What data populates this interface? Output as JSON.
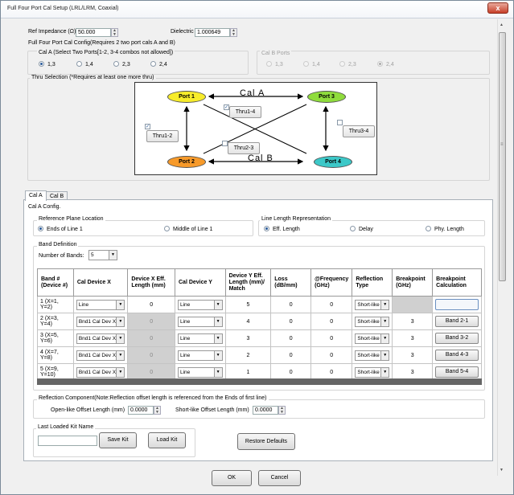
{
  "window": {
    "title": "Full Four Port Cal Setup (LRL/LRM, Coaxial)",
    "close": "x"
  },
  "ref_impedance": {
    "label": "Ref Impedance (Ω)",
    "value": "50.000"
  },
  "dielectric": {
    "label": "Dielectric",
    "value": "1.000649"
  },
  "config_title": "Full Four Port Cal Config(Requires 2 two port cals A and B)",
  "cal_a_ports": {
    "title": "Cal A (Select Two Ports[1-2, 3-4 combos not allowed])",
    "options": [
      "1,3",
      "1,4",
      "2,3",
      "2,4"
    ],
    "selected": "1,3"
  },
  "cal_b_ports": {
    "title": "Cal B Ports",
    "options": [
      "1,3",
      "1,4",
      "2,3",
      "2,4"
    ],
    "selected": "2,4"
  },
  "thru_selection": {
    "title": "Thru Selection (*Requires at least one more thru)"
  },
  "diagram": {
    "ports": [
      "Port 1",
      "Port 2",
      "Port 3",
      "Port 4"
    ],
    "cal_a": "Cal A",
    "cal_b": "Cal B",
    "thrus": [
      "Thru1-4",
      "Thru1-2",
      "Thru2-3",
      "Thru3-4"
    ],
    "checked": [
      "Thru1-4",
      "Thru1-2"
    ],
    "colors": {
      "port1": "#f7ec2a",
      "port2": "#f79a2a",
      "port3": "#8fdc3c",
      "port4": "#3cc8c8"
    }
  },
  "tabs": [
    "Cal A",
    "Cal B"
  ],
  "active_tab": "Cal A",
  "cal_a_config_label": "Cal A Config.",
  "ref_plane": {
    "title": "Reference Plane Location",
    "options": [
      "Ends of Line 1",
      "Middle of Line 1"
    ],
    "selected": "Ends of Line 1"
  },
  "line_length": {
    "title": "Line Length Representation",
    "options": [
      "Eff. Length",
      "Delay",
      "Phy. Length"
    ],
    "selected": "Eff. Length"
  },
  "band_def": {
    "title": "Band Definition",
    "num_bands_label": "Number of Bands:",
    "num_bands": "5"
  },
  "table": {
    "headers": [
      "Band #\n(Device #)",
      "Cal Device X",
      "Device X Eff.\nLength (mm)",
      "Cal Device Y",
      "Device Y Eff.\nLength (mm)/\nMatch",
      "Loss\n(dB/mm)",
      "@Frequency\n(GHz)",
      "Reflection\nType",
      "Breakpoint\n(GHz)",
      "Breakpoint\nCalculation"
    ],
    "rows": [
      {
        "band": "1 (X=1, Y=2)",
        "dev_x": "Line",
        "x_len": "0",
        "dev_y": "Line",
        "y_len": "5",
        "loss": "0",
        "freq": "0",
        "refl": "Short-like",
        "bp": "",
        "calc": ""
      },
      {
        "band": "2 (X=3, Y=4)",
        "dev_x": "Bnd1 Cal Dev X",
        "x_len": "0",
        "dev_y": "Line",
        "y_len": "4",
        "loss": "0",
        "freq": "0",
        "refl": "Short-like",
        "bp": "3",
        "calc": "Band 2-1"
      },
      {
        "band": "3 (X=5, Y=6)",
        "dev_x": "Bnd1 Cal Dev X",
        "x_len": "0",
        "dev_y": "Line",
        "y_len": "3",
        "loss": "0",
        "freq": "0",
        "refl": "Short-like",
        "bp": "3",
        "calc": "Band 3-2"
      },
      {
        "band": "4 (X=7, Y=8)",
        "dev_x": "Bnd1 Cal Dev X",
        "x_len": "0",
        "dev_y": "Line",
        "y_len": "2",
        "loss": "0",
        "freq": "0",
        "refl": "Short-like",
        "bp": "3",
        "calc": "Band 4-3"
      },
      {
        "band": "5 (X=9, Y=10)",
        "dev_x": "Bnd1 Cal Dev X",
        "x_len": "0",
        "dev_y": "Line",
        "y_len": "1",
        "loss": "0",
        "freq": "0",
        "refl": "Short-like",
        "bp": "3",
        "calc": "Band 5-4"
      }
    ]
  },
  "reflection": {
    "title": "Reflection Component(Note:Reflection offset length is referenced from the Ends of first line)",
    "open_label": "Open-like Offset Length (mm)",
    "open_value": "0.0000",
    "short_label": "Short-like Offset Length (mm)",
    "short_value": "0.0000"
  },
  "kit": {
    "title": "Last Loaded Kit Name",
    "value": "",
    "save": "Save Kit",
    "load": "Load Kit"
  },
  "restore": "Restore Defaults",
  "ok": "OK",
  "cancel": "Cancel"
}
